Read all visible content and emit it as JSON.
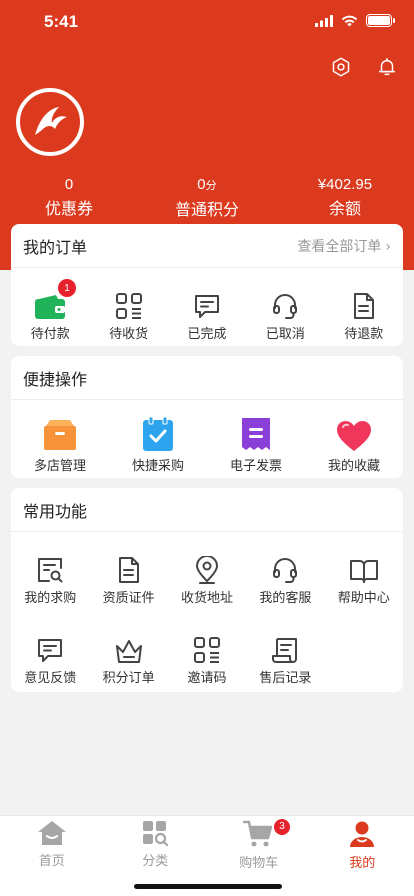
{
  "status": {
    "time": "5:41"
  },
  "stats": [
    {
      "value": "0",
      "unit": "",
      "label": "优惠券"
    },
    {
      "value": "0",
      "unit": "分",
      "label": "普通积分"
    },
    {
      "value": "¥402.95",
      "unit": "",
      "label": "余额"
    }
  ],
  "orders": {
    "title": "我的订单",
    "view_all": "查看全部订单",
    "items": [
      {
        "label": "待付款",
        "icon": "wallet-icon",
        "badge": "1"
      },
      {
        "label": "待收货",
        "icon": "qr-box-icon"
      },
      {
        "label": "已完成",
        "icon": "message-check-icon"
      },
      {
        "label": "已取消",
        "icon": "headset-icon"
      },
      {
        "label": "待退款",
        "icon": "document-icon"
      }
    ]
  },
  "shortcuts": {
    "title": "便捷操作",
    "items": [
      {
        "label": "多店管理",
        "icon": "box-icon",
        "color": "#f7943a"
      },
      {
        "label": "快捷采购",
        "icon": "clipboard-check-icon",
        "color": "#2ea4ef"
      },
      {
        "label": "电子发票",
        "icon": "receipt-icon",
        "color": "#8b3fd9"
      },
      {
        "label": "我的收藏",
        "icon": "heart-icon",
        "color": "#f0365a"
      }
    ]
  },
  "functions": {
    "title": "常用功能",
    "items": [
      {
        "label": "我的求购",
        "icon": "search-doc-icon"
      },
      {
        "label": "资质证件",
        "icon": "certificate-icon"
      },
      {
        "label": "收货地址",
        "icon": "location-icon"
      },
      {
        "label": "我的客服",
        "icon": "headset-icon"
      },
      {
        "label": "帮助中心",
        "icon": "book-icon"
      },
      {
        "label": "意见反馈",
        "icon": "feedback-icon"
      },
      {
        "label": "积分订单",
        "icon": "crown-icon"
      },
      {
        "label": "邀请码",
        "icon": "qr-code-icon"
      },
      {
        "label": "售后记录",
        "icon": "scroll-icon"
      }
    ]
  },
  "tabbar": {
    "items": [
      {
        "label": "首页",
        "icon": "home-icon",
        "active": false
      },
      {
        "label": "分类",
        "icon": "category-icon",
        "active": false
      },
      {
        "label": "购物车",
        "icon": "cart-icon",
        "active": false,
        "badge": "3"
      },
      {
        "label": "我的",
        "icon": "profile-icon",
        "active": true
      }
    ]
  },
  "colors": {
    "brand": "#dc3a1e",
    "badge": "#e8222c"
  }
}
